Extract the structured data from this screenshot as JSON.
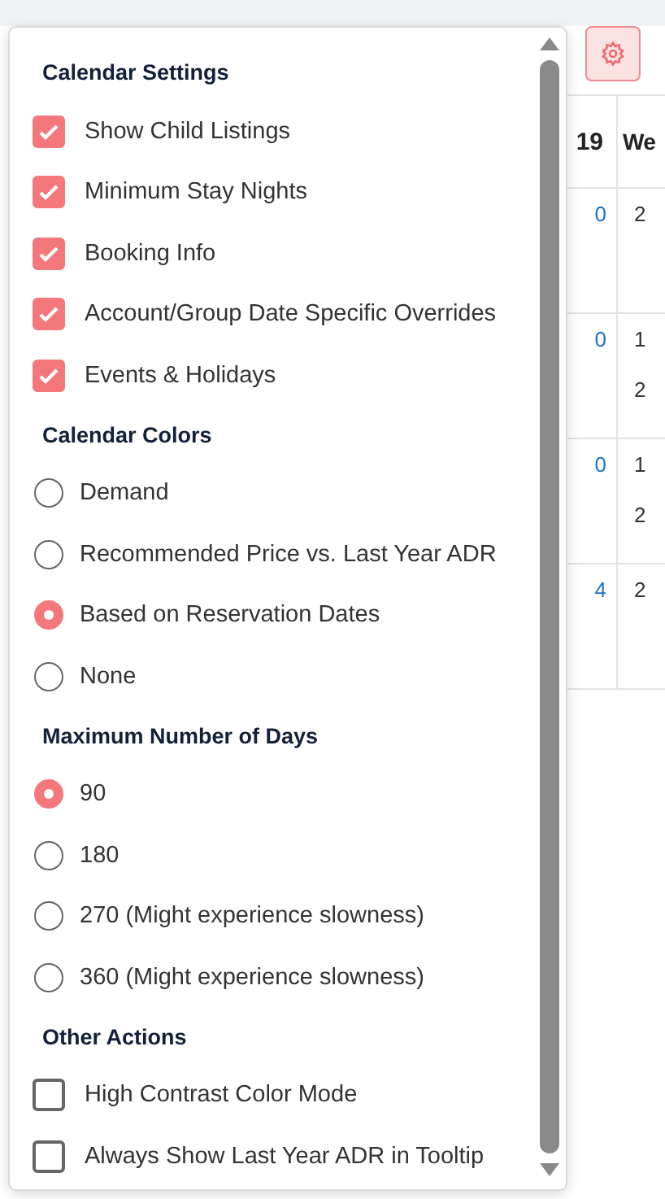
{
  "calendar": {
    "headers": [
      "19",
      "We"
    ],
    "rows": [
      [
        "0",
        "2"
      ],
      [
        "0",
        "1",
        "2"
      ],
      [
        "0",
        "1",
        "2"
      ],
      [
        "4",
        "2"
      ]
    ]
  },
  "settings_menu": {
    "sections": [
      {
        "title": "Calendar Settings",
        "items": [
          {
            "kind": "checkbox",
            "label": "Show Child Listings",
            "checked": true
          },
          {
            "kind": "checkbox",
            "label": "Minimum Stay Nights",
            "checked": true
          },
          {
            "kind": "checkbox",
            "label": "Booking Info",
            "checked": true
          },
          {
            "kind": "checkbox",
            "label": "Account/Group Date Specific Overrides",
            "checked": true
          },
          {
            "kind": "checkbox",
            "label": "Events & Holidays",
            "checked": true
          }
        ]
      },
      {
        "title": "Calendar Colors",
        "items": [
          {
            "kind": "radio",
            "label": "Demand",
            "selected": false
          },
          {
            "kind": "radio",
            "label": "Recommended Price vs. Last Year ADR",
            "selected": false
          },
          {
            "kind": "radio",
            "label": "Based on Reservation Dates",
            "selected": true
          },
          {
            "kind": "radio",
            "label": "None",
            "selected": false
          }
        ]
      },
      {
        "title": "Maximum Number of Days",
        "items": [
          {
            "kind": "radio",
            "label": "90",
            "selected": true
          },
          {
            "kind": "radio",
            "label": "180",
            "selected": false
          },
          {
            "kind": "radio",
            "label": "270 (Might experience slowness)",
            "selected": false
          },
          {
            "kind": "radio",
            "label": "360 (Might experience slowness)",
            "selected": false
          }
        ]
      },
      {
        "title": "Other Actions",
        "items": [
          {
            "kind": "checkbox",
            "label": "High Contrast Color Mode",
            "checked": false
          },
          {
            "kind": "checkbox",
            "label": "Always Show Last Year ADR in Tooltip",
            "checked": false
          }
        ]
      }
    ]
  }
}
